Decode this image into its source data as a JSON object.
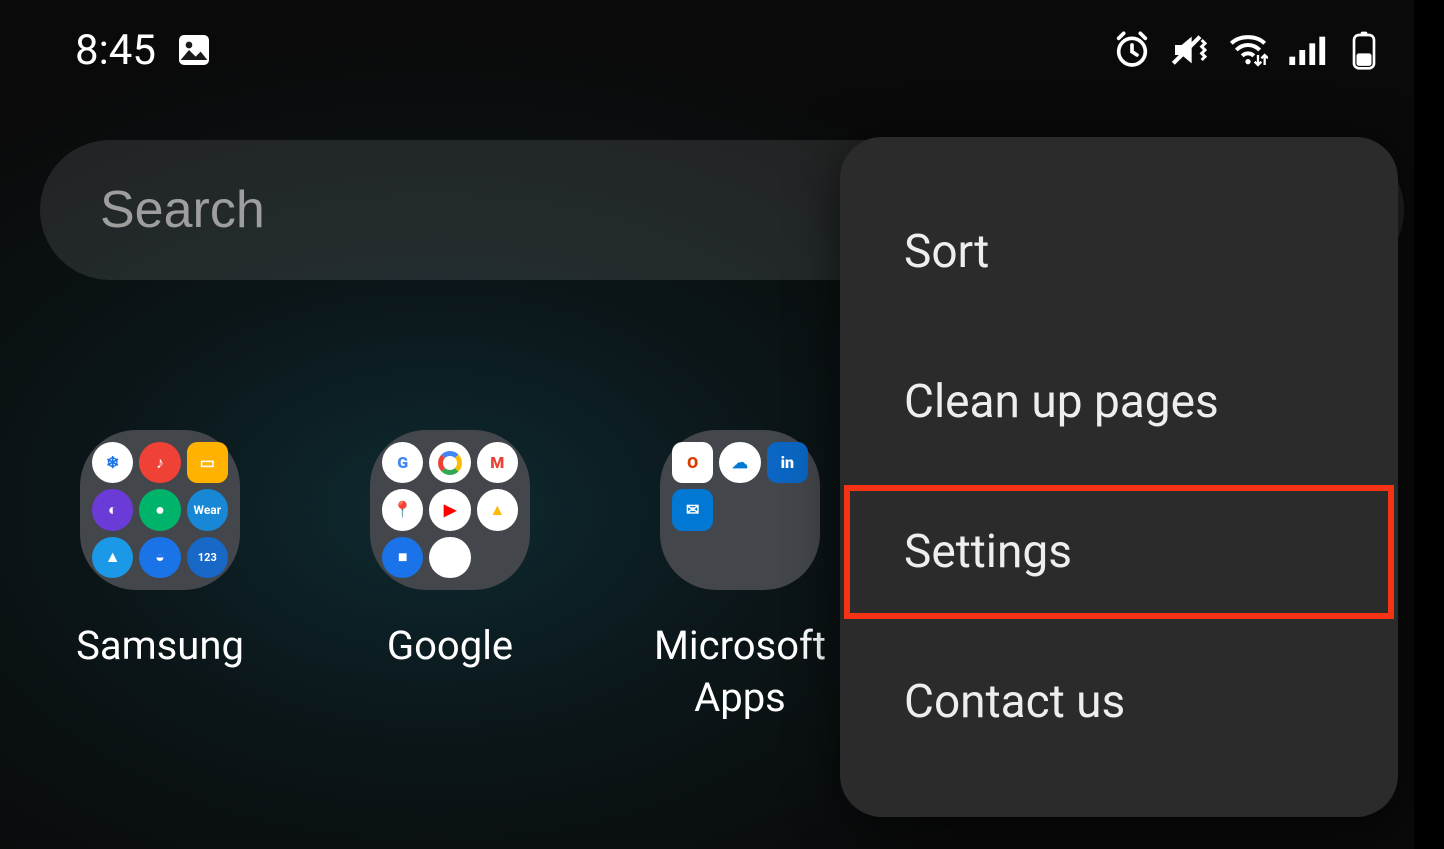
{
  "status": {
    "time": "8:45"
  },
  "search": {
    "placeholder": "Search"
  },
  "folders": [
    {
      "label": "Samsung"
    },
    {
      "label": "Google"
    },
    {
      "label": "Microsoft\nApps"
    }
  ],
  "menu": {
    "items": [
      {
        "label": "Sort",
        "highlighted": false
      },
      {
        "label": "Clean up pages",
        "highlighted": false
      },
      {
        "label": "Settings",
        "highlighted": true
      },
      {
        "label": "Contact us",
        "highlighted": false
      }
    ]
  }
}
